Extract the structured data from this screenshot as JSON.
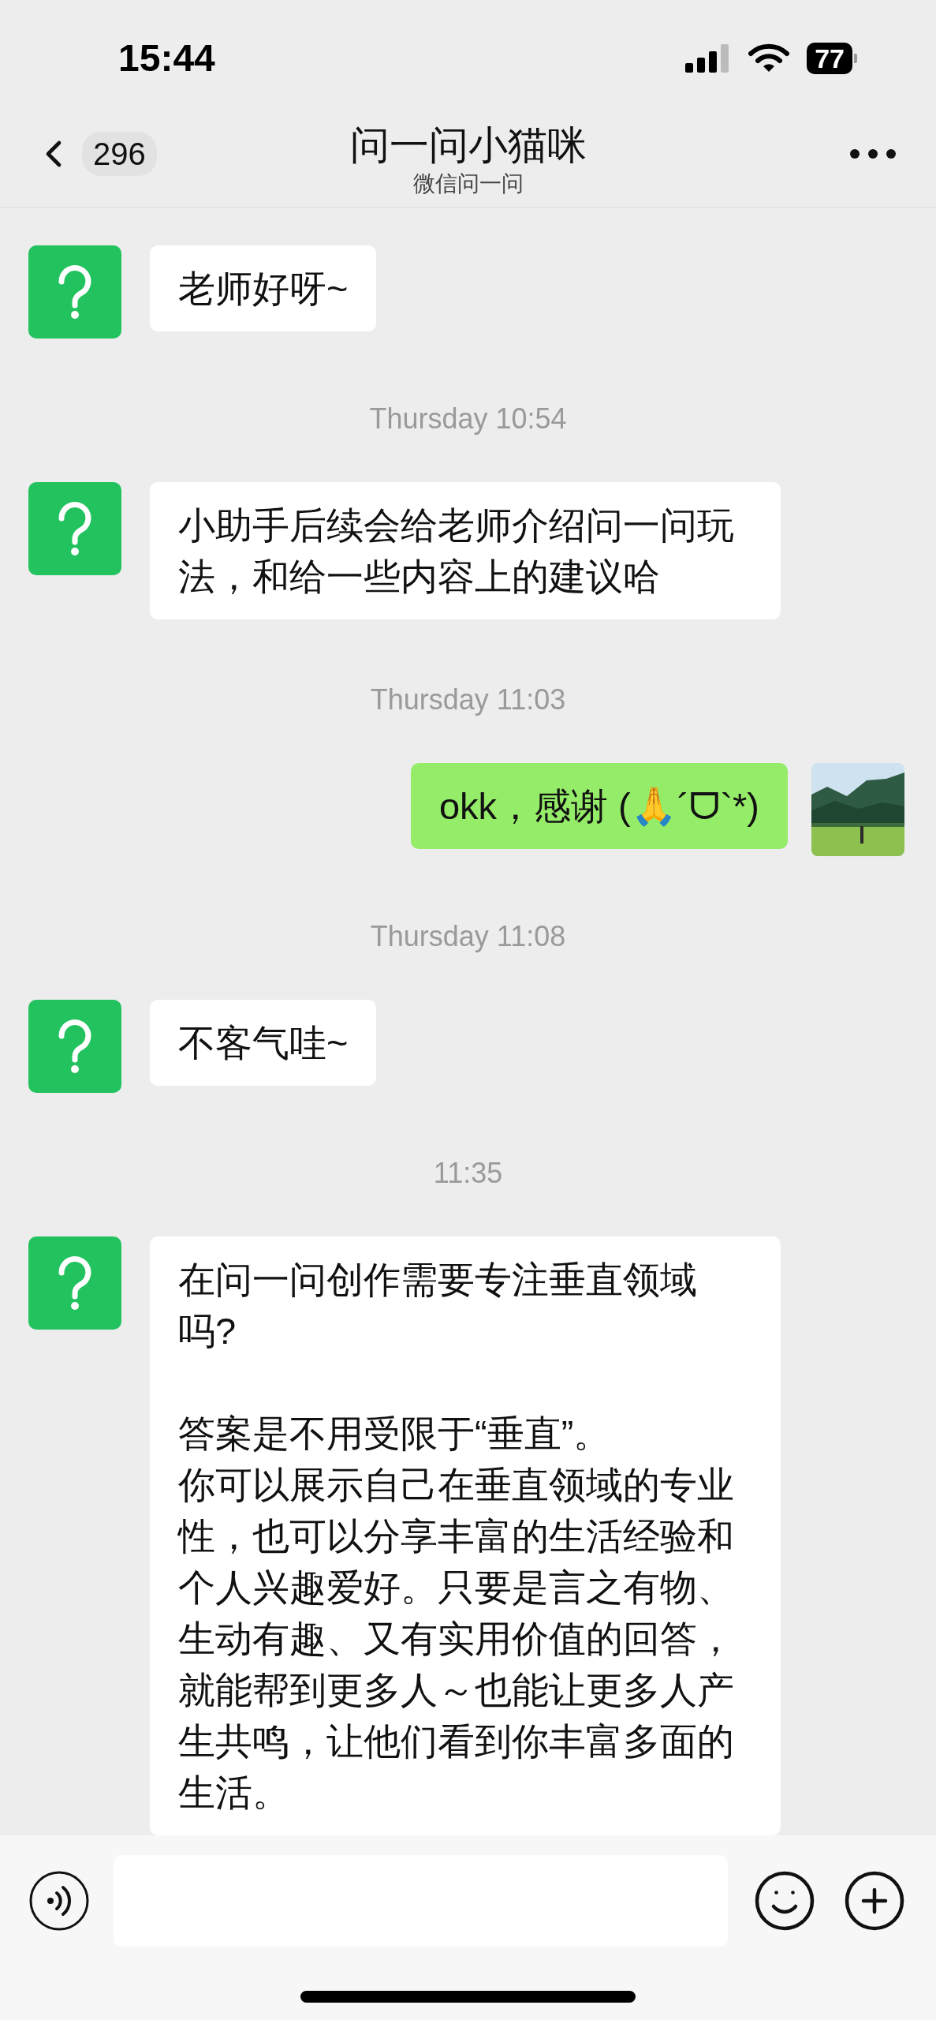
{
  "status_bar": {
    "time": "15:44",
    "battery": "77"
  },
  "header": {
    "back_count": "296",
    "title": "问一问小猫咪",
    "subtitle": "微信问一问"
  },
  "messages": [
    {
      "kind": "received",
      "text": "老师好呀~"
    },
    {
      "kind": "time",
      "text": "Thursday 10:54"
    },
    {
      "kind": "received",
      "text": "小助手后续会给老师介绍问一问玩法，和给一些内容上的建议哈"
    },
    {
      "kind": "time",
      "text": "Thursday 11:03"
    },
    {
      "kind": "sent",
      "text": "okk，感谢 (🙏´ᗜ`*)"
    },
    {
      "kind": "time",
      "text": "Thursday 11:08"
    },
    {
      "kind": "received",
      "text": "不客气哇~"
    },
    {
      "kind": "time",
      "text": "11:35"
    },
    {
      "kind": "received",
      "sections": [
        [
          "在问一问创作需要专注垂直领域吗?"
        ],
        [
          "答案是不用受限于“垂直”。",
          "你可以展示自己在垂直领域的专业性，也可以分享丰富的生活经验和个人兴趣爱好。只要是言之有物、生动有趣、又有实用价值的回答，就能帮到更多人～也能让更多人产生共鸣，让他们看到你丰富多面的生活。"
        ]
      ]
    }
  ]
}
